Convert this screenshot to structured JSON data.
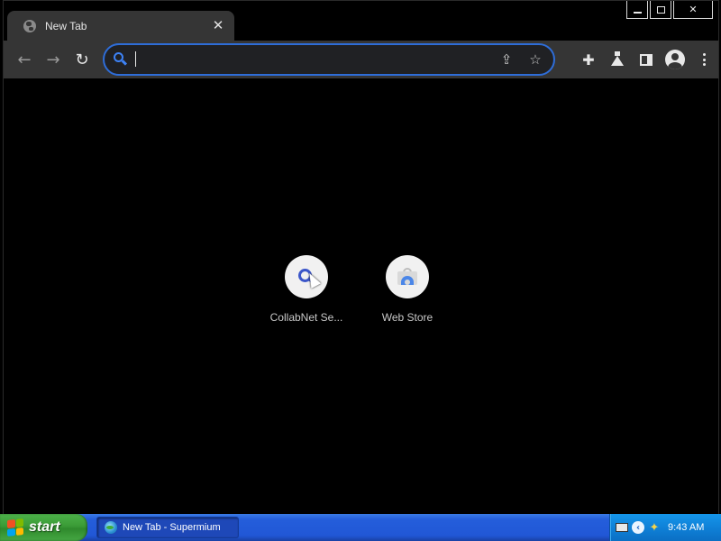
{
  "window": {
    "tab_title": "New Tab",
    "tab_close": "✕",
    "min_label": "",
    "close_label": "✕"
  },
  "toolbar": {
    "back_glyph": "←",
    "forward_glyph": "→",
    "reload_glyph": "↻",
    "omnibox_value": "",
    "share_glyph": "⇪",
    "star_glyph": "☆",
    "extensions_glyph": "✚"
  },
  "shortcuts": [
    {
      "label": "CollabNet Se...",
      "icon": "search-icon"
    },
    {
      "label": "Web Store",
      "icon": "web-store-icon"
    }
  ],
  "taskbar": {
    "start_label": "start",
    "task_label": "New Tab - Supermium",
    "clock": "9:43 AM",
    "chevron": "‹",
    "wand": "✦"
  },
  "colors": {
    "omnibox_border": "#2e6dd8",
    "toolbar_bg": "#353535",
    "taskbar_blue": "#245edb",
    "start_green": "#3a9a36"
  }
}
